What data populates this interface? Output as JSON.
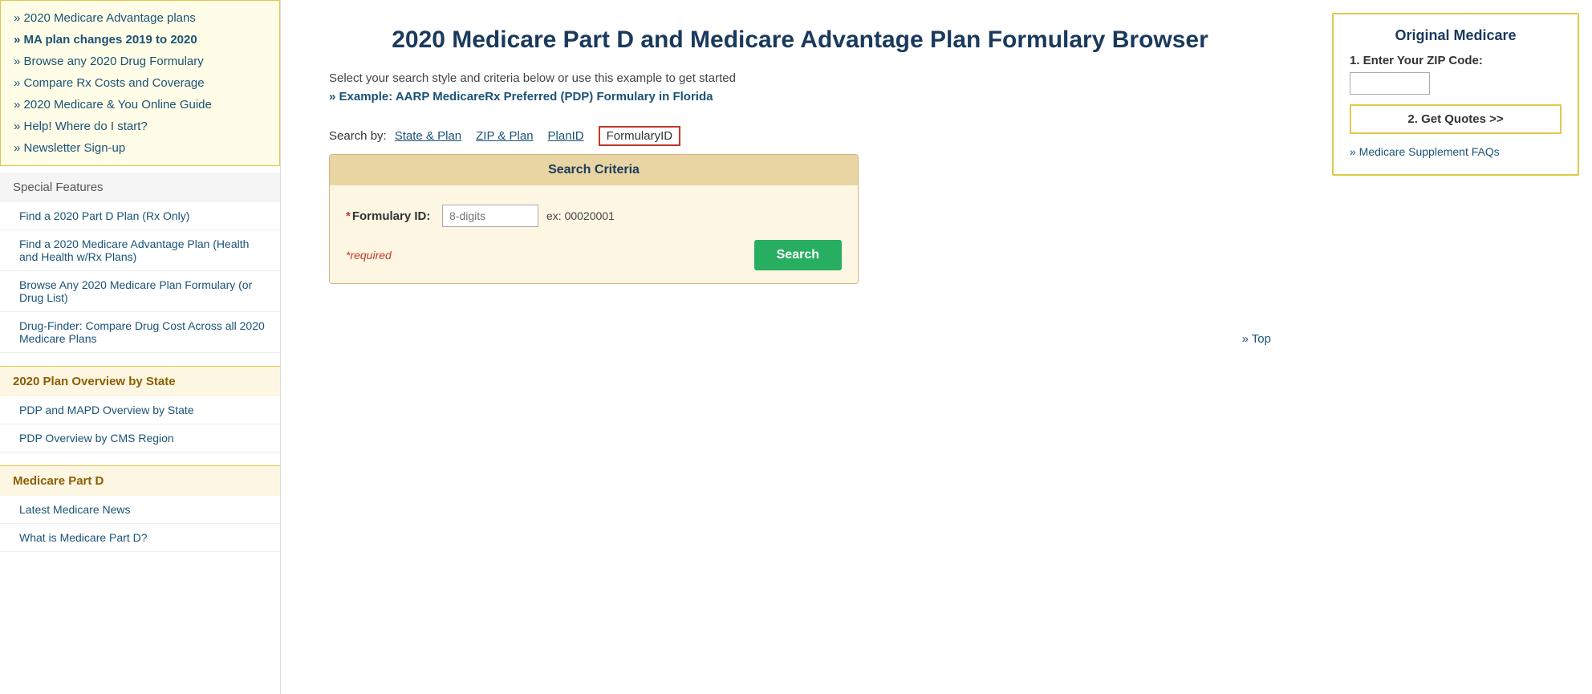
{
  "sidebar": {
    "nav_top": [
      {
        "label": "» 2020 Medicare Advantage plans",
        "id": "nav-ma-plans"
      },
      {
        "label": "» MA plan changes 2019 to 2020",
        "id": "nav-ma-changes",
        "active": true
      },
      {
        "label": "» Browse any 2020 Drug Formulary",
        "id": "nav-drug-formulary"
      },
      {
        "label": "» Compare Rx Costs and Coverage",
        "id": "nav-compare-rx"
      },
      {
        "label": "» 2020 Medicare & You Online Guide",
        "id": "nav-online-guide"
      },
      {
        "label": "» Help! Where do I start?",
        "id": "nav-help"
      },
      {
        "label": "» Newsletter Sign-up",
        "id": "nav-newsletter"
      }
    ],
    "special_features_title": "Special Features",
    "special_features": [
      {
        "label": "Find a 2020 Part D Plan (Rx Only)",
        "id": "sf-part-d"
      },
      {
        "label": "Find a 2020 Medicare Advantage Plan (Health and Health w/Rx Plans)",
        "id": "sf-ma-plan"
      },
      {
        "label": "Browse Any 2020 Medicare Plan Formulary (or Drug List)",
        "id": "sf-formulary"
      },
      {
        "label": "Drug-Finder: Compare Drug Cost Across all 2020 Medicare Plans",
        "id": "sf-drug-finder"
      }
    ],
    "state_overview_title": "2020 Plan Overview by State",
    "state_overview": [
      {
        "label": "PDP and MAPD Overview by State",
        "id": "so-pdp-mapd"
      },
      {
        "label": "PDP Overview by CMS Region",
        "id": "so-pdp-region"
      }
    ],
    "medicare_part_d_title": "Medicare Part D",
    "medicare_part_d": [
      {
        "label": "Latest Medicare News",
        "id": "mpd-news"
      },
      {
        "label": "What is Medicare Part D?",
        "id": "mpd-what-is"
      }
    ]
  },
  "main": {
    "page_title": "2020 Medicare Part D and Medicare Advantage Plan Formulary Browser",
    "subtitle": "Select your search style and criteria below or use this example to get started",
    "example_link": "» Example: AARP MedicareRx Preferred (PDP) Formulary in Florida",
    "search_by_label": "Search by:",
    "search_tabs": [
      {
        "label": "State & Plan",
        "id": "tab-state-plan",
        "active": false
      },
      {
        "label": "ZIP & Plan",
        "id": "tab-zip-plan",
        "active": false
      },
      {
        "label": "PlanID",
        "id": "tab-plan-id",
        "active": false
      },
      {
        "label": "FormularyID",
        "id": "tab-formulary-id",
        "active": true
      }
    ],
    "search_criteria": {
      "title": "Search Criteria",
      "formulary_label": "Formulary ID:",
      "formulary_placeholder": "8-digits",
      "formulary_hint": "ex: 00020001",
      "required_note": "*required",
      "search_button_label": "Search"
    },
    "top_link": "» Top"
  },
  "right_panel": {
    "title": "Original Medicare",
    "zip_label": "1. Enter Your ZIP Code:",
    "zip_placeholder": "",
    "get_quotes_label": "2. Get Quotes >>",
    "supplement_link": "» Medicare Supplement FAQs"
  }
}
